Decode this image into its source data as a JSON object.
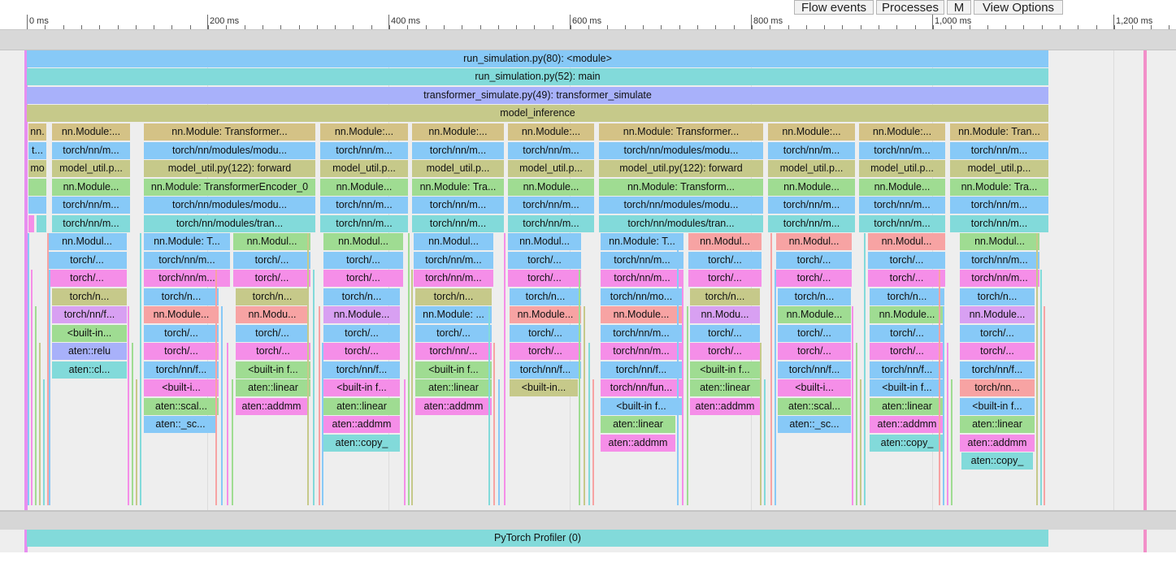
{
  "toolbar": {
    "flow_events": "Flow events",
    "processes": "Processes",
    "m": "M",
    "view_options": "View Options"
  },
  "ruler": {
    "ticks": [
      "0 ms",
      "200 ms",
      "400 ms",
      "600 ms",
      "800 ms",
      "1,000 ms",
      "1,200 ms"
    ]
  },
  "colors": {
    "blue": "#87c9f7",
    "teal": "#82dada",
    "lav": "#a8b1fa",
    "olive": "#c6c98a",
    "tan": "#d4c286",
    "green": "#9fdc92",
    "pink": "#f58ee8",
    "salmon": "#f7a3a3",
    "violet": "#d8a0f2"
  },
  "main_rows": [
    "run_simulation.py(80): <module>",
    "run_simulation.py(52): main",
    "transformer_simulate.py(49): transformer_simulate",
    "model_inference"
  ],
  "profiler_label": "PyTorch Profiler (0)",
  "slices": [
    {
      "t": "nn.",
      "r": 4,
      "c": "tan"
    },
    {
      "t": "nn.Module:...",
      "r": 4,
      "c": "tan"
    },
    {
      "t": "nn.Module: Transformer...",
      "r": 4,
      "c": "tan"
    },
    {
      "t": "nn.Module:...",
      "r": 4,
      "c": "tan"
    },
    {
      "t": "nn.Module:...",
      "r": 4,
      "c": "tan"
    },
    {
      "t": "nn.Module:...",
      "r": 4,
      "c": "tan"
    },
    {
      "t": "nn.Module: Transformer...",
      "r": 4,
      "c": "tan"
    },
    {
      "t": "nn.Module:...",
      "r": 4,
      "c": "tan"
    },
    {
      "t": "nn.Module:...",
      "r": 4,
      "c": "tan"
    },
    {
      "t": "nn.Module: Tran...",
      "r": 4,
      "c": "tan"
    },
    {
      "t": "t...",
      "r": 5,
      "c": "blue"
    },
    {
      "t": "torch/nn/m...",
      "r": 5,
      "c": "blue"
    },
    {
      "t": "torch/nn/modules/modu...",
      "r": 5,
      "c": "blue"
    },
    {
      "t": "torch/nn/m...",
      "r": 5,
      "c": "blue"
    },
    {
      "t": "torch/nn/m...",
      "r": 5,
      "c": "blue"
    },
    {
      "t": "torch/nn/m...",
      "r": 5,
      "c": "blue"
    },
    {
      "t": "torch/nn/modules/modu...",
      "r": 5,
      "c": "blue"
    },
    {
      "t": "torch/nn/m...",
      "r": 5,
      "c": "blue"
    },
    {
      "t": "torch/nn/m...",
      "r": 5,
      "c": "blue"
    },
    {
      "t": "torch/nn/m...",
      "r": 5,
      "c": "blue"
    },
    {
      "t": "mo",
      "r": 6,
      "c": "olive"
    },
    {
      "t": "model_util.p...",
      "r": 6,
      "c": "olive"
    },
    {
      "t": "model_util.py(122): forward",
      "r": 6,
      "c": "olive"
    },
    {
      "t": "model_util.p...",
      "r": 6,
      "c": "olive"
    },
    {
      "t": "model_util.p...",
      "r": 6,
      "c": "olive"
    },
    {
      "t": "model_util.p...",
      "r": 6,
      "c": "olive"
    },
    {
      "t": "model_util.py(122): forward",
      "r": 6,
      "c": "olive"
    },
    {
      "t": "model_util.p...",
      "r": 6,
      "c": "olive"
    },
    {
      "t": "model_util.p...",
      "r": 6,
      "c": "olive"
    },
    {
      "t": "model_util.p...",
      "r": 6,
      "c": "olive"
    },
    {
      "t": "",
      "r": 7,
      "c": "green"
    },
    {
      "t": "nn.Module...",
      "r": 7,
      "c": "green"
    },
    {
      "t": "nn.Module: TransformerEncoder_0",
      "r": 7,
      "c": "green"
    },
    {
      "t": "nn.Module...",
      "r": 7,
      "c": "green"
    },
    {
      "t": "nn.Module: Tra...",
      "r": 7,
      "c": "green"
    },
    {
      "t": "nn.Module...",
      "r": 7,
      "c": "green"
    },
    {
      "t": "nn.Module: Transform...",
      "r": 7,
      "c": "green"
    },
    {
      "t": "nn.Module...",
      "r": 7,
      "c": "green"
    },
    {
      "t": "nn.Module...",
      "r": 7,
      "c": "green"
    },
    {
      "t": "nn.Module: Tra...",
      "r": 7,
      "c": "green"
    },
    {
      "t": "",
      "r": 8,
      "c": "blue"
    },
    {
      "t": "torch/nn/m...",
      "r": 8,
      "c": "blue"
    },
    {
      "t": "torch/nn/modules/modu...",
      "r": 8,
      "c": "blue"
    },
    {
      "t": "torch/nn/m...",
      "r": 8,
      "c": "blue"
    },
    {
      "t": "torch/nn/m...",
      "r": 8,
      "c": "blue"
    },
    {
      "t": "torch/nn/m...",
      "r": 8,
      "c": "blue"
    },
    {
      "t": "torch/nn/modules/modu...",
      "r": 8,
      "c": "blue"
    },
    {
      "t": "torch/nn/m...",
      "r": 8,
      "c": "blue"
    },
    {
      "t": "torch/nn/m...",
      "r": 8,
      "c": "blue"
    },
    {
      "t": "torch/nn/m...",
      "r": 8,
      "c": "blue"
    },
    {
      "t": "",
      "r": 9,
      "c": "pink"
    },
    {
      "t": "",
      "r": 9,
      "c": "teal"
    },
    {
      "t": "torch/nn/m...",
      "r": 9,
      "c": "teal"
    },
    {
      "t": "torch/nn/modules/tran...",
      "r": 9,
      "c": "teal"
    },
    {
      "t": "torch/nn/m...",
      "r": 9,
      "c": "teal"
    },
    {
      "t": "torch/nn/m...",
      "r": 9,
      "c": "teal"
    },
    {
      "t": "torch/nn/m...",
      "r": 9,
      "c": "teal"
    },
    {
      "t": "torch/nn/modules/tran...",
      "r": 9,
      "c": "teal"
    },
    {
      "t": "torch/nn/m...",
      "r": 9,
      "c": "teal"
    },
    {
      "t": "torch/nn/m...",
      "r": 9,
      "c": "teal"
    },
    {
      "t": "torch/nn/m...",
      "r": 9,
      "c": "teal"
    },
    {
      "t": "nn.Modul...",
      "r": 10,
      "c": "blue"
    },
    {
      "t": "nn.Module: T...",
      "r": 10,
      "c": "blue"
    },
    {
      "t": "nn.Modul...",
      "r": 10,
      "c": "green"
    },
    {
      "t": "nn.Modul...",
      "r": 10,
      "c": "green"
    },
    {
      "t": "nn.Modul...",
      "r": 10,
      "c": "blue"
    },
    {
      "t": "nn.Modul...",
      "r": 10,
      "c": "blue"
    },
    {
      "t": "nn.Module: T...",
      "r": 10,
      "c": "blue"
    },
    {
      "t": "nn.Modul...",
      "r": 10,
      "c": "salmon"
    },
    {
      "t": "nn.Modul...",
      "r": 10,
      "c": "salmon"
    },
    {
      "t": "nn.Modul...",
      "r": 10,
      "c": "salmon"
    },
    {
      "t": "nn.Modul...",
      "r": 10,
      "c": "green"
    },
    {
      "t": "torch/...",
      "r": 11,
      "c": "blue"
    },
    {
      "t": "torch/nn/m...",
      "r": 11,
      "c": "blue"
    },
    {
      "t": "torch/...",
      "r": 11,
      "c": "blue"
    },
    {
      "t": "torch/...",
      "r": 11,
      "c": "blue"
    },
    {
      "t": "torch/nn/m...",
      "r": 11,
      "c": "blue"
    },
    {
      "t": "torch/...",
      "r": 11,
      "c": "blue"
    },
    {
      "t": "torch/nn/m...",
      "r": 11,
      "c": "blue"
    },
    {
      "t": "torch/...",
      "r": 11,
      "c": "blue"
    },
    {
      "t": "torch/...",
      "r": 11,
      "c": "blue"
    },
    {
      "t": "torch/...",
      "r": 11,
      "c": "blue"
    },
    {
      "t": "torch/nn/m...",
      "r": 11,
      "c": "blue"
    },
    {
      "t": "torch/...",
      "r": 12,
      "c": "pink"
    },
    {
      "t": "torch/nn/m...",
      "r": 12,
      "c": "pink"
    },
    {
      "t": "torch/...",
      "r": 12,
      "c": "pink"
    },
    {
      "t": "torch/...",
      "r": 12,
      "c": "pink"
    },
    {
      "t": "torch/nn/m...",
      "r": 12,
      "c": "pink"
    },
    {
      "t": "torch/...",
      "r": 12,
      "c": "pink"
    },
    {
      "t": "torch/nn/m...",
      "r": 12,
      "c": "pink"
    },
    {
      "t": "torch/...",
      "r": 12,
      "c": "pink"
    },
    {
      "t": "torch/...",
      "r": 12,
      "c": "pink"
    },
    {
      "t": "torch/...",
      "r": 12,
      "c": "pink"
    },
    {
      "t": "torch/nn/m...",
      "r": 12,
      "c": "pink"
    },
    {
      "t": "torch/n...",
      "r": 13,
      "c": "olive"
    },
    {
      "t": "torch/n...",
      "r": 13,
      "c": "blue"
    },
    {
      "t": "torch/n...",
      "r": 13,
      "c": "olive"
    },
    {
      "t": "torch/n...",
      "r": 13,
      "c": "blue"
    },
    {
      "t": "torch/n...",
      "r": 13,
      "c": "olive"
    },
    {
      "t": "torch/n...",
      "r": 13,
      "c": "blue"
    },
    {
      "t": "torch/nn/mo...",
      "r": 13,
      "c": "blue"
    },
    {
      "t": "torch/n...",
      "r": 13,
      "c": "olive"
    },
    {
      "t": "torch/n...",
      "r": 13,
      "c": "blue"
    },
    {
      "t": "torch/n...",
      "r": 13,
      "c": "blue"
    },
    {
      "t": "torch/n...",
      "r": 13,
      "c": "blue"
    },
    {
      "t": "torch/nn/f...",
      "r": 14,
      "c": "violet"
    },
    {
      "t": "nn.Module...",
      "r": 14,
      "c": "salmon"
    },
    {
      "t": "nn.Modu...",
      "r": 14,
      "c": "salmon"
    },
    {
      "t": "nn.Module...",
      "r": 14,
      "c": "violet"
    },
    {
      "t": "nn.Module: ...",
      "r": 14,
      "c": "blue"
    },
    {
      "t": "nn.Module...",
      "r": 14,
      "c": "salmon"
    },
    {
      "t": "nn.Module...",
      "r": 14,
      "c": "salmon"
    },
    {
      "t": "nn.Modu...",
      "r": 14,
      "c": "violet"
    },
    {
      "t": "nn.Module...",
      "r": 14,
      "c": "green"
    },
    {
      "t": "nn.Module...",
      "r": 14,
      "c": "green"
    },
    {
      "t": "nn.Module...",
      "r": 14,
      "c": "violet"
    },
    {
      "t": "<built-in...",
      "r": 15,
      "c": "green"
    },
    {
      "t": "torch/...",
      "r": 15,
      "c": "blue"
    },
    {
      "t": "torch/...",
      "r": 15,
      "c": "blue"
    },
    {
      "t": "torch/...",
      "r": 15,
      "c": "blue"
    },
    {
      "t": "torch/...",
      "r": 15,
      "c": "blue"
    },
    {
      "t": "torch/...",
      "r": 15,
      "c": "blue"
    },
    {
      "t": "torch/nn/m...",
      "r": 15,
      "c": "blue"
    },
    {
      "t": "torch/...",
      "r": 15,
      "c": "blue"
    },
    {
      "t": "torch/...",
      "r": 15,
      "c": "blue"
    },
    {
      "t": "torch/...",
      "r": 15,
      "c": "blue"
    },
    {
      "t": "torch/...",
      "r": 15,
      "c": "blue"
    },
    {
      "t": "aten::relu",
      "r": 16,
      "c": "lav"
    },
    {
      "t": "torch/...",
      "r": 16,
      "c": "pink"
    },
    {
      "t": "torch/...",
      "r": 16,
      "c": "pink"
    },
    {
      "t": "torch/...",
      "r": 16,
      "c": "pink"
    },
    {
      "t": "torch/nn/...",
      "r": 16,
      "c": "pink"
    },
    {
      "t": "torch/...",
      "r": 16,
      "c": "pink"
    },
    {
      "t": "torch/nn/m...",
      "r": 16,
      "c": "pink"
    },
    {
      "t": "torch/...",
      "r": 16,
      "c": "pink"
    },
    {
      "t": "torch/...",
      "r": 16,
      "c": "pink"
    },
    {
      "t": "torch/...",
      "r": 16,
      "c": "pink"
    },
    {
      "t": "torch/...",
      "r": 16,
      "c": "pink"
    },
    {
      "t": "aten::cl...",
      "r": 17,
      "c": "teal"
    },
    {
      "t": "torch/nn/f...",
      "r": 17,
      "c": "blue"
    },
    {
      "t": "<built-in f...",
      "r": 17,
      "c": "green"
    },
    {
      "t": "torch/nn/f...",
      "r": 17,
      "c": "blue"
    },
    {
      "t": "<built-in f...",
      "r": 17,
      "c": "green"
    },
    {
      "t": "torch/nn/f...",
      "r": 17,
      "c": "blue"
    },
    {
      "t": "torch/nn/f...",
      "r": 17,
      "c": "blue"
    },
    {
      "t": "<built-in f...",
      "r": 17,
      "c": "green"
    },
    {
      "t": "torch/nn/f...",
      "r": 17,
      "c": "blue"
    },
    {
      "t": "torch/nn/f...",
      "r": 17,
      "c": "blue"
    },
    {
      "t": "torch/nn/f...",
      "r": 17,
      "c": "blue"
    },
    {
      "t": "<built-i...",
      "r": 18,
      "c": "pink"
    },
    {
      "t": "aten::linear",
      "r": 18,
      "c": "green"
    },
    {
      "t": "<built-in f...",
      "r": 18,
      "c": "pink"
    },
    {
      "t": "aten::linear",
      "r": 18,
      "c": "green"
    },
    {
      "t": "<built-in...",
      "r": 18,
      "c": "olive"
    },
    {
      "t": "torch/nn/fun...",
      "r": 18,
      "c": "pink"
    },
    {
      "t": "aten::linear",
      "r": 18,
      "c": "green"
    },
    {
      "t": "<built-i...",
      "r": 18,
      "c": "pink"
    },
    {
      "t": "<built-in f...",
      "r": 18,
      "c": "blue"
    },
    {
      "t": "torch/nn...",
      "r": 18,
      "c": "salmon"
    },
    {
      "t": "aten::scal...",
      "r": 19,
      "c": "green"
    },
    {
      "t": "aten::addmm",
      "r": 19,
      "c": "pink"
    },
    {
      "t": "aten::linear",
      "r": 19,
      "c": "green"
    },
    {
      "t": "aten::addmm",
      "r": 19,
      "c": "pink"
    },
    {
      "t": "<built-in f...",
      "r": 19,
      "c": "blue"
    },
    {
      "t": "aten::addmm",
      "r": 19,
      "c": "pink"
    },
    {
      "t": "aten::scal...",
      "r": 19,
      "c": "green"
    },
    {
      "t": "aten::linear",
      "r": 19,
      "c": "green"
    },
    {
      "t": "<built-in f...",
      "r": 19,
      "c": "blue"
    },
    {
      "t": "aten::_sc...",
      "r": 20,
      "c": "blue"
    },
    {
      "t": "aten::addmm",
      "r": 20,
      "c": "pink"
    },
    {
      "t": "aten::linear",
      "r": 20,
      "c": "green"
    },
    {
      "t": "aten::_sc...",
      "r": 20,
      "c": "blue"
    },
    {
      "t": "aten::addmm",
      "r": 20,
      "c": "pink"
    },
    {
      "t": "aten::linear",
      "r": 20,
      "c": "green"
    },
    {
      "t": "aten::copy_",
      "r": 21,
      "c": "teal"
    },
    {
      "t": "aten::addmm",
      "r": 21,
      "c": "pink"
    },
    {
      "t": "aten::copy_",
      "r": 21,
      "c": "teal"
    },
    {
      "t": "aten::addmm",
      "r": 21,
      "c": "pink"
    },
    {
      "t": "aten::copy_",
      "r": 22,
      "c": "teal"
    }
  ]
}
